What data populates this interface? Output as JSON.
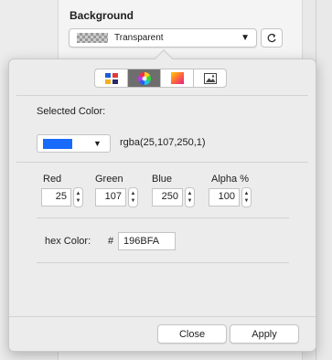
{
  "background_section": {
    "title": "Background",
    "select_value": "Transparent",
    "reset_icon": "refresh-icon"
  },
  "popover": {
    "tabs": [
      {
        "name": "palette-grid-icon"
      },
      {
        "name": "color-wheel-icon",
        "active": true
      },
      {
        "name": "gradient-icon"
      },
      {
        "name": "image-icon"
      }
    ],
    "selected_color_label": "Selected Color:",
    "rgba_text": "rgba(25,107,250,1)",
    "swatch_color": "#196bfa",
    "channels": [
      {
        "label": "Red",
        "value": "25"
      },
      {
        "label": "Green",
        "value": "107"
      },
      {
        "label": "Blue",
        "value": "250"
      },
      {
        "label": "Alpha %",
        "value": "100"
      }
    ],
    "hex_label": "hex Color:",
    "hex_prefix": "#",
    "hex_value": "196BFA",
    "close_label": "Close",
    "apply_label": "Apply"
  }
}
